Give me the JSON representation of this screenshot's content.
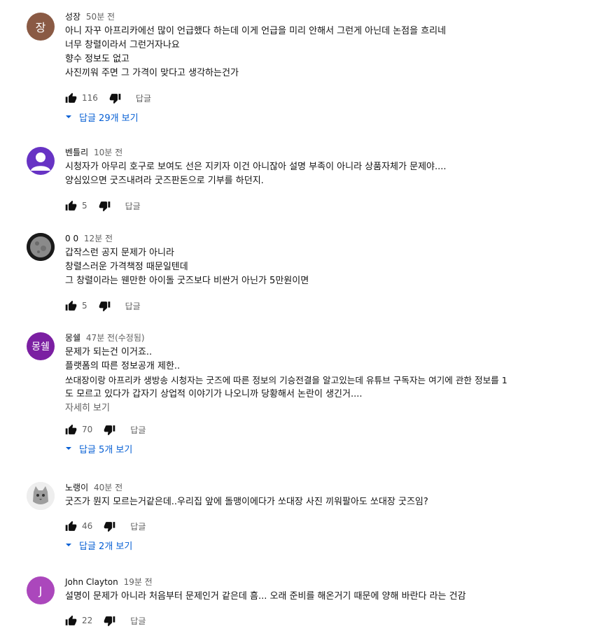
{
  "labels": {
    "reply": "답글",
    "read_more": "자세히 보기"
  },
  "colors": {
    "link": "#065fd4",
    "meta": "#606060"
  },
  "comments": [
    {
      "avatar_text": "장",
      "avatar_color": "#8a5a44",
      "author": "성장",
      "time": "50분 전",
      "lines": [
        "아니 자꾸 아프리카에선 많이 언급했다 하는데 이게 언급을 미리 안해서 그런게 아닌데 논점을 흐리네",
        "너무 창렬이라서 그런거자나요",
        "향수 정보도 없고",
        "사진끼워 주면 그 가격이 맞다고 생각하는건가"
      ],
      "likes": "116",
      "replies": "답글 29개 보기"
    },
    {
      "avatar_text": "",
      "avatar_color": "#6733c4",
      "author": "벤틀리",
      "time": "10분 전",
      "lines": [
        "시청자가 아무리 호구로 보여도 선은 지키자 이건 아니잖아 설명 부족이 아니라 상품자체가 문제야....",
        "양심있으면 굿즈내려라 굿즈판돈으로 기부를 하던지."
      ],
      "likes": "5"
    },
    {
      "avatar_text": "",
      "avatar_color": "#222222",
      "author": "0 0",
      "time": "12분 전",
      "lines": [
        "갑작스런 공지 문제가 아니라",
        "창렬스러운 가격책정 때문일텐데",
        "그 창렬이라는 웬만한 아이돌 굿즈보다 비싼거 아닌가 5만원이면"
      ],
      "likes": "5"
    },
    {
      "avatar_text": "몽쉘",
      "avatar_color": "#7b1fa2",
      "author": "몽쉘",
      "time": "47분 전(수정됨)",
      "lines": [
        "문제가 되는건 이거죠..",
        "플랫폼의 따른 정보공개 제한..",
        "쏘대장이랑 아프리카 생방송 시청자는 굿즈에 따른 정보의 기승전결을 알고있는데 유튜브 구독자는 여기에 관한 정보를 1",
        "도 모르고 있다가 갑자기 상업적 이야기가 나오니까 당황해서 논란이 생긴거...."
      ],
      "show_more": true,
      "likes": "70",
      "replies": "답글 5개 보기"
    },
    {
      "avatar_text": "",
      "avatar_color": "#e8e8e8",
      "author": "노랭이",
      "time": "40분 전",
      "lines": [
        "굿즈가 뭔지 모르는거같은데..우리집 앞에 돌맹이에다가 쏘대장 사진 끼워팔아도 쏘대장 굿즈임?"
      ],
      "likes": "46",
      "replies": "답글 2개 보기"
    },
    {
      "avatar_text": "J",
      "avatar_color": "#ab47bc",
      "author": "John Clayton",
      "time": "19분 전",
      "lines": [
        "설명이 문제가 아니라 처음부터 문제인거 같은데 흠... 오래 준비를 해온거기 때문에 양해 바란다 라는 건감"
      ],
      "likes": "22"
    }
  ]
}
